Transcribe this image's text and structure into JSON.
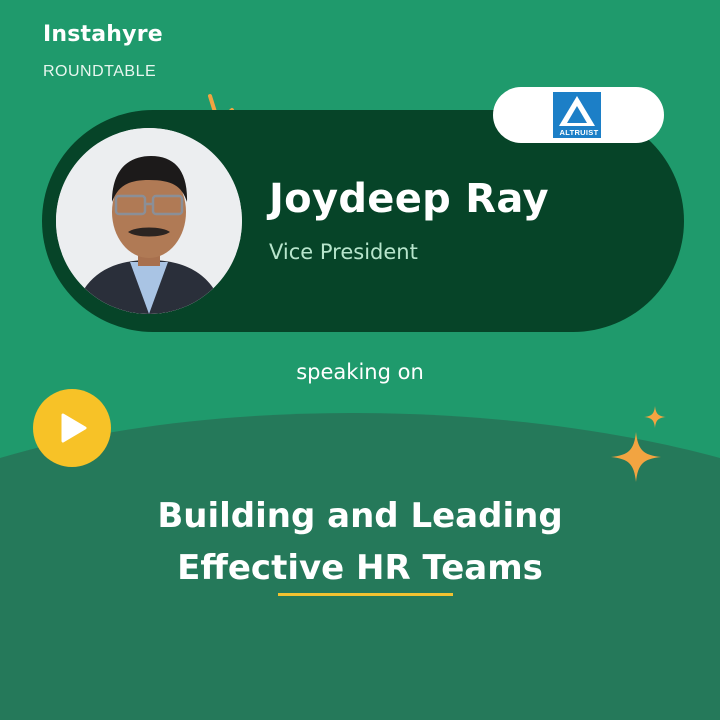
{
  "brand": {
    "name": "Instahyre",
    "subtitle": "ROUNDTABLE"
  },
  "speaker": {
    "name": "Joydeep Ray",
    "role": "Vice President"
  },
  "company_logo": {
    "text": "ALTRUIST"
  },
  "speaking_label": "speaking on",
  "topic": {
    "line1": "Building and Leading",
    "line2": "Effective HR Teams"
  },
  "colors": {
    "background": "#1f9a6c",
    "lower_panel": "#25795a",
    "pill": "#064428",
    "accent_yellow": "#f7c227",
    "accent_orange": "#f2a441",
    "logo_blue": "#1c7fc7"
  },
  "icons": [
    "play-icon",
    "sparkle-icon",
    "deco-lines-icon"
  ]
}
